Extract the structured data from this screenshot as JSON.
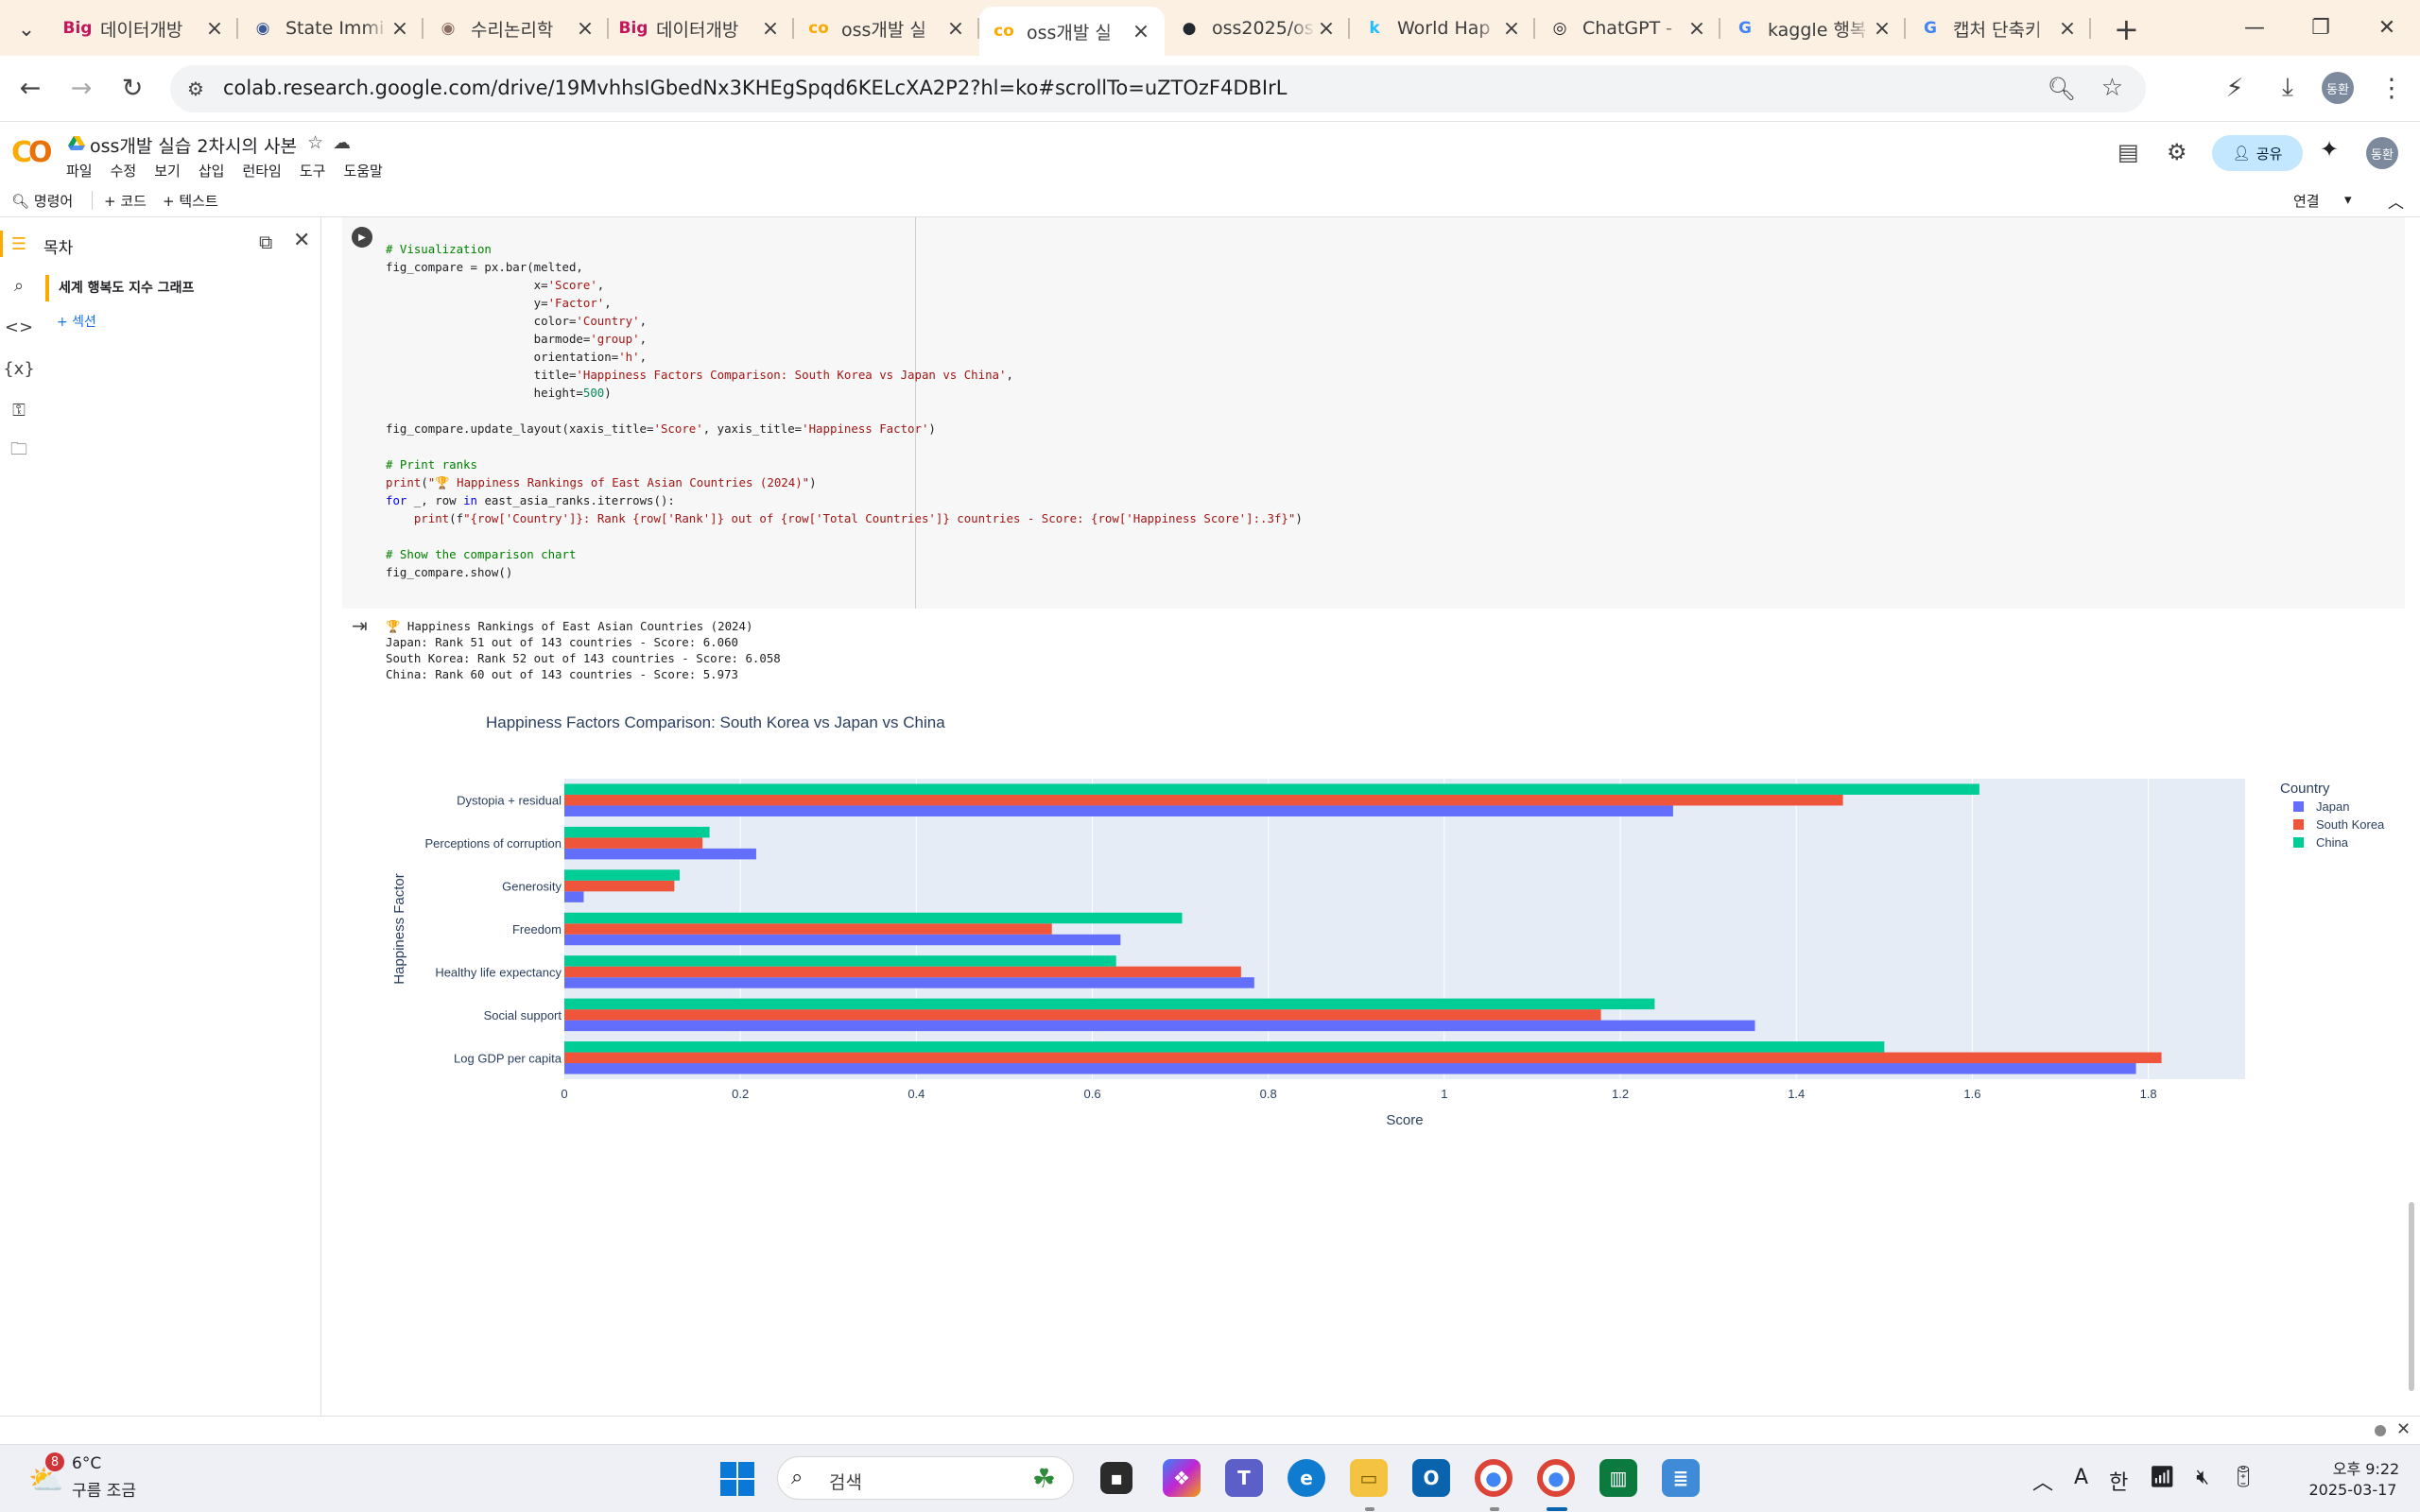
{
  "browser": {
    "tabs": [
      {
        "favicon": "Big",
        "favicon_color": "#c2185b",
        "title": "데이터개방",
        "active": false
      },
      {
        "favicon": "◉",
        "favicon_color": "#3b5998",
        "title": "State Immi",
        "active": false
      },
      {
        "favicon": "◉",
        "favicon_color": "#8d6e63",
        "title": "수리논리학",
        "active": false
      },
      {
        "favicon": "Big",
        "favicon_color": "#c2185b",
        "title": "데이터개방",
        "active": false
      },
      {
        "favicon": "co",
        "favicon_color": "#f9ab00",
        "title": "oss개발 실",
        "active": false
      },
      {
        "favicon": "co",
        "favicon_color": "#f9ab00",
        "title": "oss개발 실",
        "active": true
      },
      {
        "favicon": "●",
        "favicon_color": "#24292f",
        "title": "oss2025/os",
        "active": false
      },
      {
        "favicon": "k",
        "favicon_color": "#20beff",
        "title": "World Hap",
        "active": false
      },
      {
        "favicon": "◎",
        "favicon_color": "#202124",
        "title": "ChatGPT -",
        "active": false
      },
      {
        "favicon": "G",
        "favicon_color": "#4285f4",
        "title": "kaggle 행복",
        "active": false
      },
      {
        "favicon": "G",
        "favicon_color": "#4285f4",
        "title": "캡처 단축키",
        "active": false
      }
    ],
    "url": "colab.research.google.com/drive/19MvhhsIGbedNx3KHEgSpqd6KELcXA2P2?hl=ko#scrollTo=uZTOzF4DBIrL",
    "profile_initials": "동환"
  },
  "colab": {
    "notebook_title": "oss개발 실습 2차시의 사본",
    "menu": [
      "파일",
      "수정",
      "보기",
      "삽입",
      "런타임",
      "도구",
      "도움말"
    ],
    "share_label": "공유",
    "toolbar": {
      "command_palette": "명령어",
      "add_code": "+ 코드",
      "add_text": "+ 텍스트",
      "connect": "연결"
    },
    "toc": {
      "title": "목차",
      "items": [
        "세계 행복도 지수 그래프"
      ],
      "add_section": "+ 섹션"
    },
    "output_lines": [
      "🏆 Happiness Rankings of East Asian Countries (2024)",
      "Japan: Rank 51 out of 143 countries - Score: 6.060",
      "South Korea: Rank 52 out of 143 countries - Score: 6.058",
      "China: Rank 60 out of 143 countries - Score: 5.973"
    ]
  },
  "chart_data": {
    "type": "bar",
    "orientation": "h",
    "title": "Happiness Factors Comparison: South Korea vs Japan vs China",
    "xlabel": "Score",
    "ylabel": "Happiness Factor",
    "legend_title": "Country",
    "legend_position": "top-right",
    "categories": [
      "Log GDP per capita",
      "Social support",
      "Healthy life expectancy",
      "Freedom",
      "Generosity",
      "Perceptions of corruption",
      "Dystopia + residual"
    ],
    "xlim": [
      0,
      1.91
    ],
    "xticks": [
      0,
      0.2,
      0.4,
      0.6,
      0.8,
      1,
      1.2,
      1.4,
      1.6,
      1.8
    ],
    "grid": true,
    "series": [
      {
        "name": "Japan",
        "color": "#636efa",
        "values": [
          1.786,
          1.353,
          0.784,
          0.632,
          0.022,
          0.218,
          1.26
        ]
      },
      {
        "name": "South Korea",
        "color": "#ef553b",
        "values": [
          1.815,
          1.178,
          0.769,
          0.554,
          0.125,
          0.157,
          1.453
        ]
      },
      {
        "name": "China",
        "color": "#00cc96",
        "values": [
          1.5,
          1.239,
          0.627,
          0.702,
          0.131,
          0.165,
          1.608
        ]
      }
    ]
  },
  "taskbar": {
    "weather_badge": "8",
    "weather_temp": "6°C",
    "weather_desc": "구름 조금",
    "search_placeholder": "검색",
    "time": "오후 9:22",
    "date": "2025-03-17",
    "ime_label": "한",
    "font_label": "A"
  }
}
